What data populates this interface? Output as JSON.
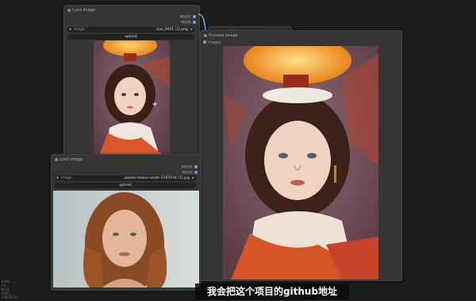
{
  "nodes": {
    "load_image_1": {
      "title": "Load Image",
      "outputs": [
        "IMAGE",
        "MASK"
      ],
      "combo_label": "image",
      "combo_value": "size_0001 (2).png",
      "upload_label": "upload"
    },
    "load_image_2": {
      "title": "Load Image",
      "outputs": [
        "IMAGE",
        "MASK"
      ],
      "combo_label": "image",
      "combo_value": "pexels-leeloo-sarah-2105434 (1).jpg",
      "upload_label": "upload"
    },
    "preview_image": {
      "title": "Preview Image",
      "input_label": "images"
    },
    "hidden_node_title": "InstantID/FaceAnalysis"
  },
  "subtitle": "我会把这个项目的github地址",
  "corner_stats": [
    "0.0fs",
    "I:0",
    "N:10",
    "V:25",
    "FPS:59.53"
  ],
  "colors": {
    "canvas": "#1c1c1c",
    "node_bg": "#353535",
    "link": "#6aa6e6"
  }
}
